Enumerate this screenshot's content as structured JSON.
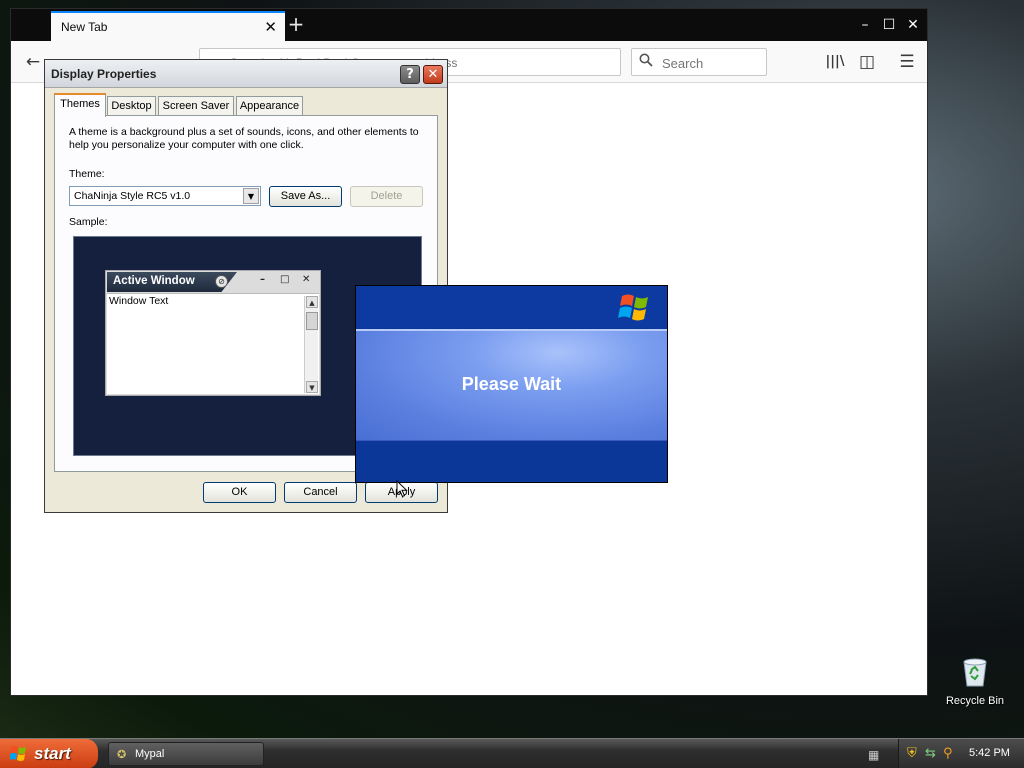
{
  "browser": {
    "tab_title": "New Tab",
    "tab_close": "✕",
    "new_tab": "+",
    "window_controls": {
      "minimize": "–",
      "maximize": "☐",
      "close": "✕"
    },
    "toolbar": {
      "back_icon": "←",
      "url_placeholder": "Search with DuckDuckGo or enter address",
      "search_placeholder": "Search",
      "library_icon": "|||\\",
      "sidebar_icon": "◫",
      "menu_icon": "☰"
    }
  },
  "dialog": {
    "title": "Display Properties",
    "help": "?",
    "close": "✕",
    "tabs": [
      "Themes",
      "Desktop",
      "Screen Saver",
      "Appearance"
    ],
    "description": "A theme is a background plus a set of sounds, icons, and other elements to help you personalize your computer with one click.",
    "theme_label": "Theme:",
    "theme_value": "ChaNinja Style RC5 v1.0",
    "save_as": "Save As...",
    "delete": "Delete",
    "sample_label": "Sample:",
    "sample": {
      "window_title": "Active Window",
      "window_text": "Window Text",
      "controls": {
        "minimize": "–",
        "maximize": "□",
        "close": "✕"
      }
    },
    "ok": "OK",
    "cancel": "Cancel",
    "apply": "Apply"
  },
  "splash": {
    "text": "Please Wait"
  },
  "desktop": {
    "recycle_bin": "Recycle Bin"
  },
  "taskbar": {
    "start": "start",
    "task_label": "Mypal",
    "clock": "5:42 PM"
  }
}
